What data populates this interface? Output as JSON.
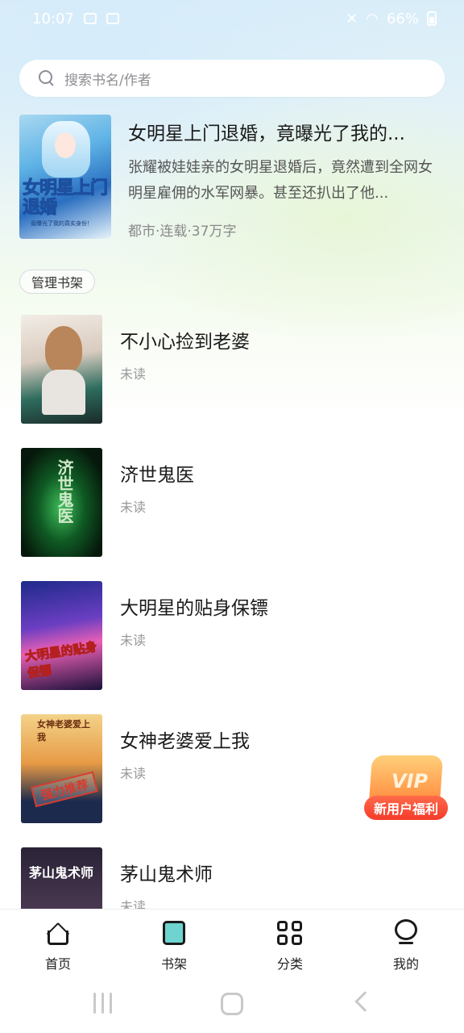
{
  "status_bar": {
    "time": "10:07",
    "battery": "66%"
  },
  "search": {
    "placeholder": "搜索书名/作者"
  },
  "featured": {
    "title": "女明星上门退婚，竟曝光了我的...",
    "description": "张耀被娃娃亲的女明星退婚后，竟然遭到全网女明星雇佣的水军网暴。甚至还扒出了他...",
    "meta": "都市·连载·37万字",
    "cover_title": "女明星上门退婚",
    "cover_subtitle": "竟曝光了我的真实身份！"
  },
  "manage_button": "管理书架",
  "books": [
    {
      "title": "不小心捡到老婆",
      "status": "未读"
    },
    {
      "title": "济世鬼医",
      "status": "未读",
      "cover_text": "济世鬼医"
    },
    {
      "title": "大明星的贴身保镖",
      "status": "未读",
      "cover_text": "大明星的贴身保镖"
    },
    {
      "title": "女神老婆爱上我",
      "status": "未读",
      "cover_text": "女神老婆爱上我",
      "stamp": "强力推荐"
    },
    {
      "title": "茅山鬼术师",
      "status": "未读",
      "cover_text": "茅山鬼术师"
    }
  ],
  "vip_badge": {
    "badge": "VIP",
    "label": "新用户福利"
  },
  "tabs": [
    {
      "label": "首页",
      "icon": "home-icon"
    },
    {
      "label": "书架",
      "icon": "bookshelf-icon",
      "active": true
    },
    {
      "label": "分类",
      "icon": "category-icon"
    },
    {
      "label": "我的",
      "icon": "profile-icon"
    }
  ]
}
